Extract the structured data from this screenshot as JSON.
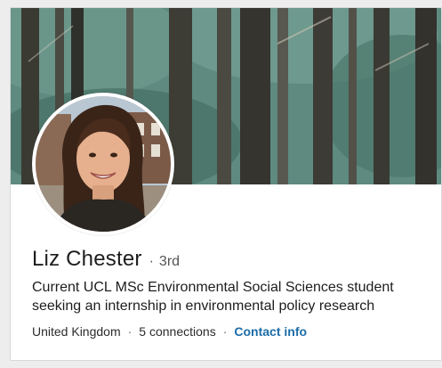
{
  "profile": {
    "name": "Liz Chester",
    "separator": "·",
    "degree": "3rd",
    "headline": "Current UCL MSc Environmental Social Sciences student seeking an internship in environmental policy research",
    "location": "United Kingdom",
    "connections": "5 connections",
    "contact_info": "Contact info"
  },
  "colors": {
    "link": "#1b6ca8",
    "cover": "#4f7b70"
  },
  "icons": {
    "cover": "forest-cover-image",
    "avatar": "profile-photo"
  }
}
